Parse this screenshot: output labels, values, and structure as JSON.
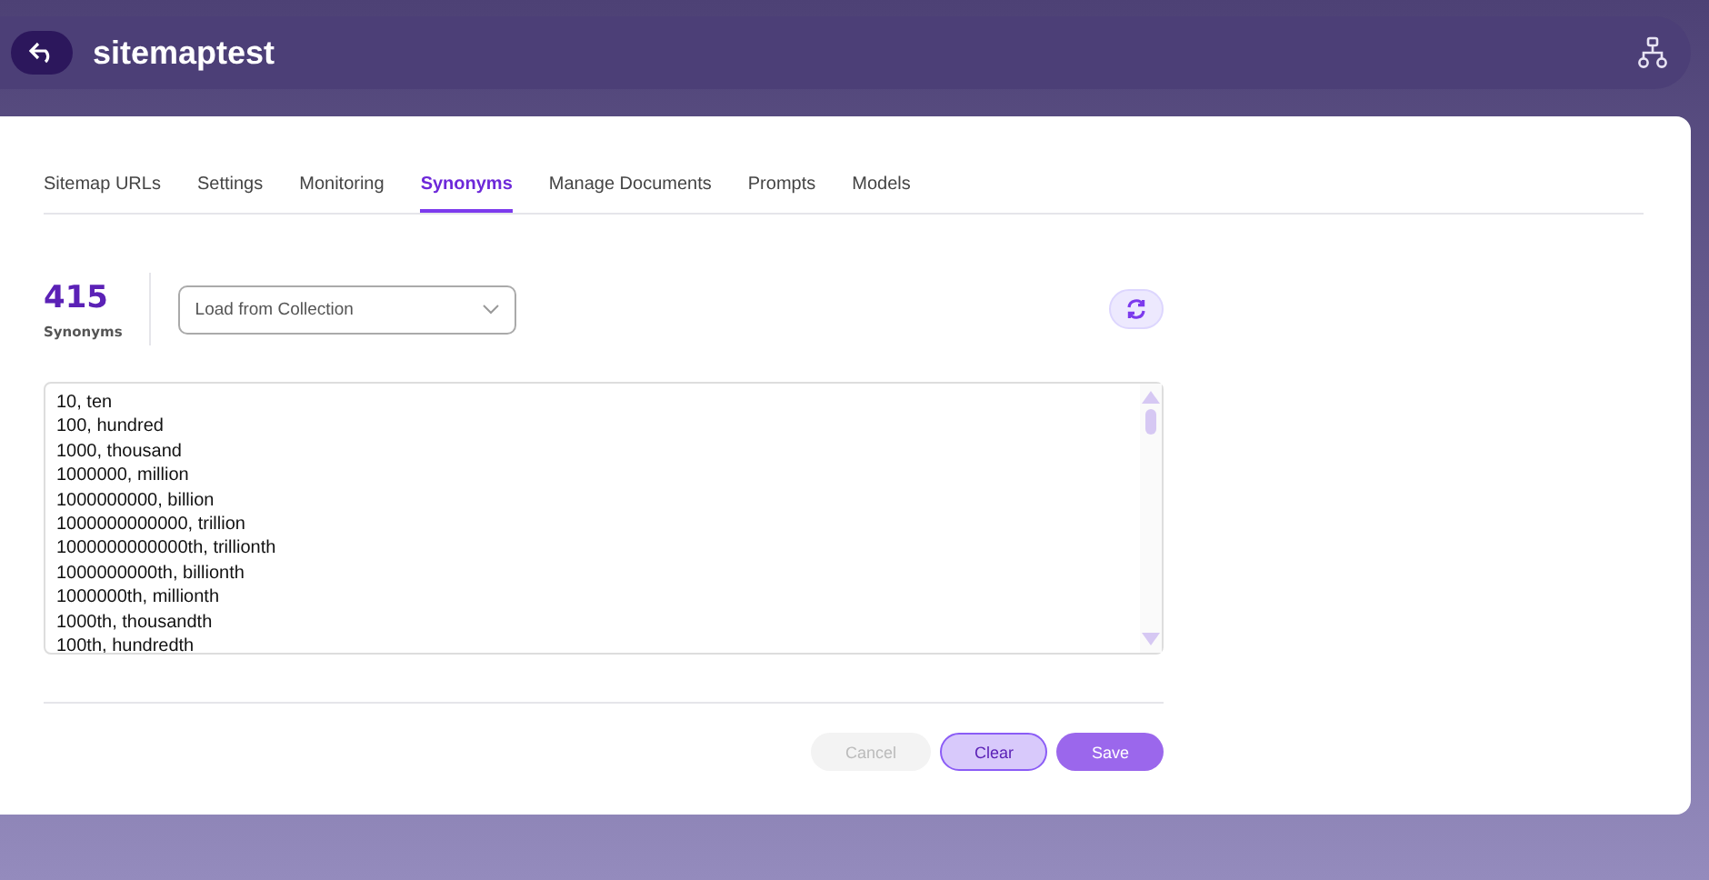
{
  "header": {
    "title": "sitemaptest"
  },
  "tabs": [
    {
      "label": "Sitemap URLs",
      "selected": false
    },
    {
      "label": "Settings",
      "selected": false
    },
    {
      "label": "Monitoring",
      "selected": false
    },
    {
      "label": "Synonyms",
      "selected": true
    },
    {
      "label": "Manage Documents",
      "selected": false
    },
    {
      "label": "Prompts",
      "selected": false
    },
    {
      "label": "Models",
      "selected": false
    }
  ],
  "stat": {
    "count": "415",
    "label": "Synonyms"
  },
  "collection_select": {
    "placeholder": "Load from Collection"
  },
  "synonyms_lines": [
    "10, ten",
    "100, hundred",
    "1000, thousand",
    "1000000, million",
    "1000000000, billion",
    "1000000000000, trillion",
    "1000000000000th, trillionth",
    "1000000000th, billionth",
    "1000000th, millionth",
    "1000th, thousandth",
    "100th, hundredth"
  ],
  "buttons": [
    {
      "label": "Cancel",
      "kind": "cancel",
      "disabled": true
    },
    {
      "label": "Clear",
      "kind": "secondary",
      "disabled": false
    },
    {
      "label": "Save",
      "kind": "primary",
      "disabled": false
    }
  ]
}
